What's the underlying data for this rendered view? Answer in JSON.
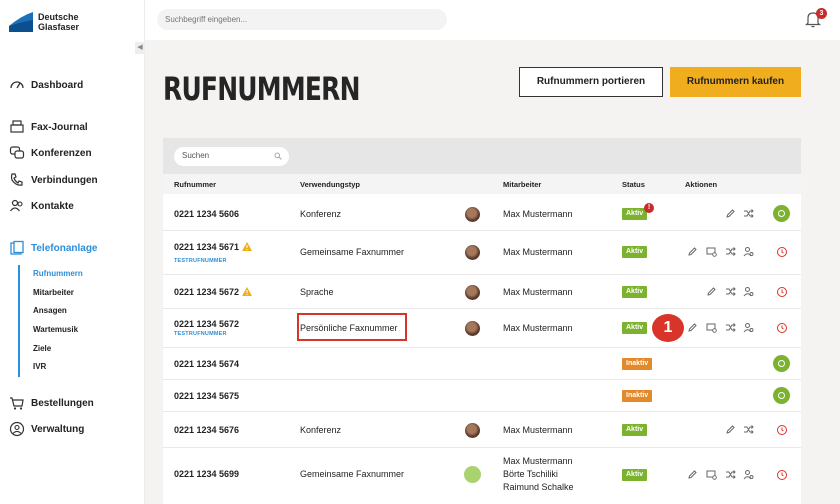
{
  "brand": {
    "line1": "Deutsche",
    "line2": "Glasfaser"
  },
  "topbar": {
    "search_placeholder": "Suchbegriff eingeben...",
    "notification_count": "3"
  },
  "sidebar": {
    "items": [
      {
        "label": "Dashboard",
        "icon": "dashboard-icon"
      },
      {
        "label": "Fax-Journal",
        "icon": "fax-icon"
      },
      {
        "label": "Konferenzen",
        "icon": "conference-icon"
      },
      {
        "label": "Verbindungen",
        "icon": "phone-icon"
      },
      {
        "label": "Kontakte",
        "icon": "contacts-icon"
      },
      {
        "label": "Telefonanlage",
        "icon": "telephone-system-icon"
      },
      {
        "label": "Bestellungen",
        "icon": "cart-icon"
      },
      {
        "label": "Verwaltung",
        "icon": "user-circle-icon"
      }
    ],
    "sub_items": [
      "Rufnummern",
      "Mitarbeiter",
      "Ansagen",
      "Wartemusik",
      "Ziele",
      "IVR"
    ]
  },
  "page": {
    "title": "RUFNUMMERN",
    "port_button": "Rufnummern portieren",
    "buy_button": "Rufnummern kaufen"
  },
  "table": {
    "search_placeholder": "Suchen",
    "headers": [
      "Rufnummer",
      "Verwendungstyp",
      "Mitarbeiter",
      "Status",
      "Aktionen"
    ],
    "rows": [
      {
        "number": "0221 1234 5606",
        "test": "",
        "type": "Konferenz",
        "employee": "Max Mustermann",
        "status": "Aktiv"
      },
      {
        "number": "0221 1234 5671",
        "test": "TESTRUFNUMMER",
        "type": "Gemeinsame Faxnummer",
        "employee": "Max Mustermann",
        "status": "Aktiv"
      },
      {
        "number": "0221 1234 5672",
        "test": "",
        "type": "Sprache",
        "employee": "Max Mustermann",
        "status": "Aktiv"
      },
      {
        "number": "0221 1234 5672",
        "test": "TESTRUFNUMMER",
        "type": "Persönliche Faxnummer",
        "employee": "Max Mustermann",
        "status": "Aktiv"
      },
      {
        "number": "0221 1234 5674",
        "test": "",
        "type": "",
        "employee": "",
        "status": "Inaktiv"
      },
      {
        "number": "0221 1234 5675",
        "test": "",
        "type": "",
        "employee": "",
        "status": "Inaktiv"
      },
      {
        "number": "0221 1234 5676",
        "test": "",
        "type": "Konferenz",
        "employee": "Max Mustermann",
        "status": "Aktiv"
      },
      {
        "number": "0221 1234 5699",
        "test": "",
        "type": "Gemeinsame Faxnummer",
        "employee_lines": [
          "Max Mustermann",
          "Börte Tschiliki",
          "Raimund Schalke"
        ],
        "status": "Aktiv"
      }
    ]
  },
  "annotations": {
    "status_alert": "!",
    "callout_number": "1"
  },
  "colors": {
    "accent": "#2d8fd8",
    "buy": "#f0ad1d",
    "active": "#7bb32e",
    "inactive": "#e4892a",
    "alert": "#d8342a"
  }
}
